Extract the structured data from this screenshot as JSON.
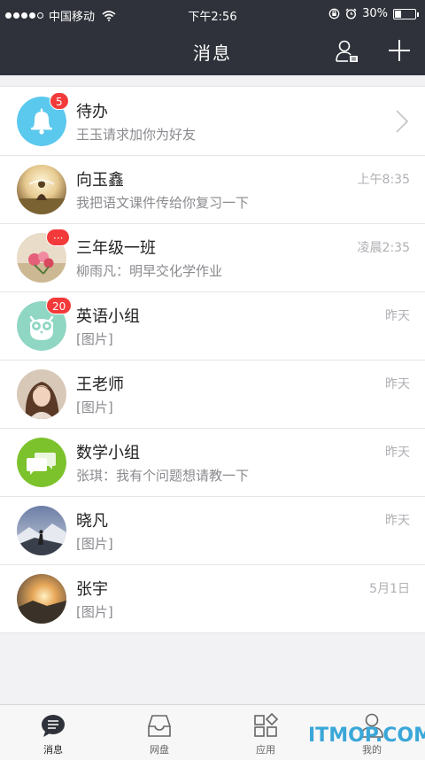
{
  "status_bar": {
    "carrier": "中国移动",
    "time": "下午2:56",
    "battery": "30%",
    "battery_level": 0.3
  },
  "nav": {
    "title": "消息"
  },
  "messages": [
    {
      "name": "待办",
      "preview": "王玉请求加你为好友",
      "time": "",
      "badge": "5",
      "avatar_icon": "bell-icon",
      "avatar_color": "#5bc8ee"
    },
    {
      "name": "向玉鑫",
      "preview": "我把语文课件传给你复习一下",
      "time": "上午8:35",
      "badge": ""
    },
    {
      "name": "三年级一班",
      "preview": "柳雨凡：明早交化学作业",
      "time": "凌晨2:35",
      "badge": "···"
    },
    {
      "name": "英语小组",
      "preview": "[图片]",
      "time": "昨天",
      "badge": "20",
      "avatar_icon": "owl-icon",
      "avatar_color": "#8fd6c3"
    },
    {
      "name": "王老师",
      "preview": "[图片]",
      "time": "昨天",
      "badge": ""
    },
    {
      "name": "数学小组",
      "preview": "张琪：我有个问题想请教一下",
      "time": "昨天",
      "badge": "",
      "avatar_icon": "chat-bubbles-icon",
      "avatar_color": "#7cc22c"
    },
    {
      "name": "晓凡",
      "preview": "[图片]",
      "time": "昨天",
      "badge": ""
    },
    {
      "name": "张宇",
      "preview": "[图片]",
      "time": "5月1日",
      "badge": ""
    }
  ],
  "tabs": [
    {
      "label": "消息",
      "icon": "message-icon",
      "active": true
    },
    {
      "label": "网盘",
      "icon": "inbox-tray-icon",
      "active": false
    },
    {
      "label": "应用",
      "icon": "apps-grid-icon",
      "active": false
    },
    {
      "label": "我的",
      "icon": "person-icon",
      "active": false
    }
  ],
  "watermark": "ITMOP.COM",
  "colors": {
    "header_bg": "#2f323a",
    "badge_red": "#f33a3a",
    "list_bg": "#ffffff",
    "page_bg": "#f2f2f5"
  }
}
